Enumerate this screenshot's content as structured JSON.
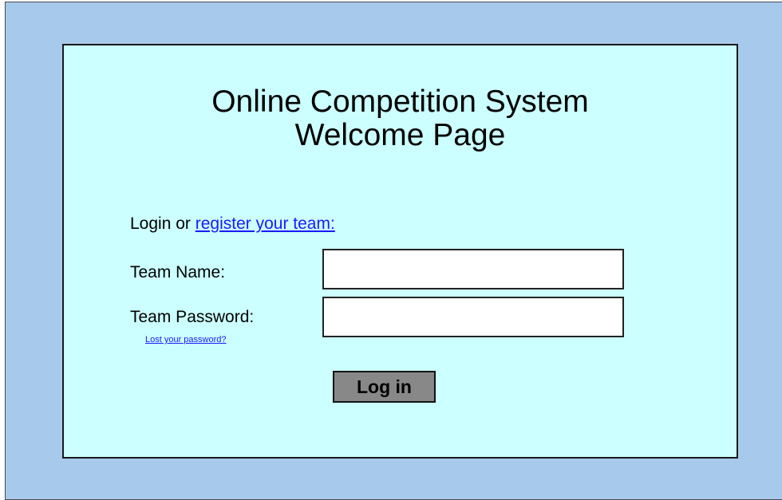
{
  "page": {
    "title_line1": "Online Competition System",
    "title_line2": "Welcome Page"
  },
  "login": {
    "intro_prefix": "Login or ",
    "register_link": "register your team:",
    "team_name_label": "Team Name:",
    "team_name_value": "",
    "team_password_label": "Team Password:",
    "team_password_value": "",
    "lost_password_link": "Lost your password?",
    "login_button": "Log in"
  },
  "colors": {
    "outer_background": "#a7caec",
    "panel_background": "#ccffff",
    "link": "#1a1aff",
    "button_background": "#888888"
  }
}
